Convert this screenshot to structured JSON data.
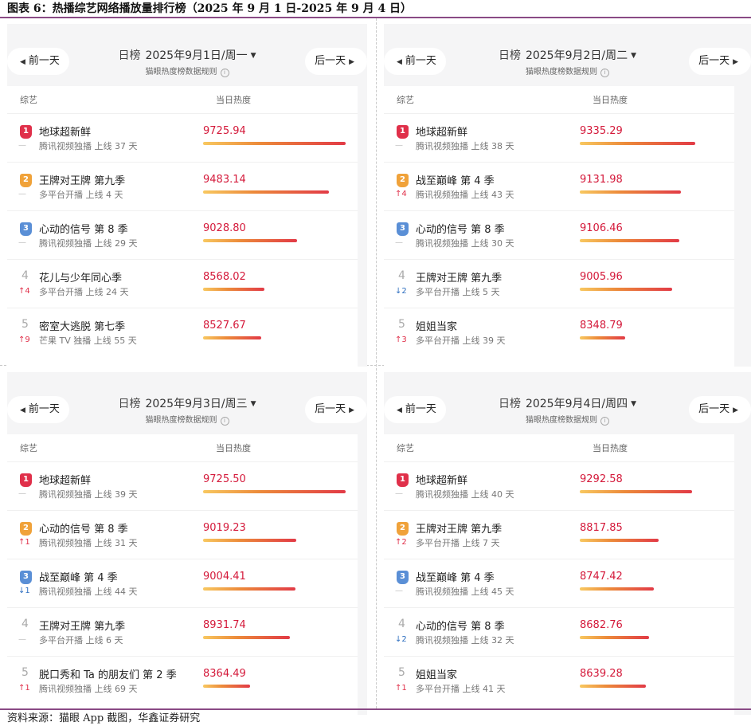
{
  "figure_title": "图表 6：热播综艺网络播放量排行榜（2025 年 9 月 1 日-2025 年 9 月 4 日）",
  "source_note": "资料来源：猫眼 App 截图，华鑫证券研究",
  "colors": {
    "rank1": "#e0304a",
    "rank2": "#f0a23a",
    "rank3": "#5a8fd6",
    "heat": "#d4193a",
    "up": "#e0304a",
    "down": "#2f6fc0"
  },
  "panels": [
    {
      "prev_label": "前一天",
      "next_label": "后一天",
      "board_label": "日榜",
      "date": "2025年9月1日/周一",
      "rule_text": "猫眼热度榜数据规则",
      "col_show": "综艺",
      "col_heat": "当日热度",
      "rows": [
        {
          "rank": "1",
          "trend_dir": "flat",
          "trend": "—",
          "name": "地球超新鲜",
          "sub": "腾讯视频独播 上线 37 天",
          "heat": "9725.94",
          "heat_value": 9725.94
        },
        {
          "rank": "2",
          "trend_dir": "flat",
          "trend": "—",
          "name": "王牌对王牌 第九季",
          "sub": "多平台开播 上线 4 天",
          "heat": "9483.14",
          "heat_value": 9483.14
        },
        {
          "rank": "3",
          "trend_dir": "flat",
          "trend": "—",
          "name": "心动的信号 第 8 季",
          "sub": "腾讯视频独播 上线 29 天",
          "heat": "9028.80",
          "heat_value": 9028.8
        },
        {
          "rank": "4",
          "trend_dir": "up",
          "trend": "↑4",
          "name": "花儿与少年同心季",
          "sub": "多平台开播 上线 24 天",
          "heat": "8568.02",
          "heat_value": 8568.02
        },
        {
          "rank": "5",
          "trend_dir": "up",
          "trend": "↑9",
          "name": "密室大逃脱 第七季",
          "sub": "芒果 TV 独播 上线 55 天",
          "heat": "8527.67",
          "heat_value": 8527.67
        }
      ]
    },
    {
      "prev_label": "前一天",
      "next_label": "后一天",
      "board_label": "日榜",
      "date": "2025年9月2日/周二",
      "rule_text": "猫眼热度榜数据规则",
      "col_show": "综艺",
      "col_heat": "当日热度",
      "rows": [
        {
          "rank": "1",
          "trend_dir": "flat",
          "trend": "—",
          "name": "地球超新鲜",
          "sub": "腾讯视频独播 上线 38 天",
          "heat": "9335.29",
          "heat_value": 9335.29
        },
        {
          "rank": "2",
          "trend_dir": "up",
          "trend": "↑4",
          "name": "战至巅峰 第 4 季",
          "sub": "腾讯视频独播 上线 43 天",
          "heat": "9131.98",
          "heat_value": 9131.98
        },
        {
          "rank": "3",
          "trend_dir": "flat",
          "trend": "—",
          "name": "心动的信号 第 8 季",
          "sub": "腾讯视频独播 上线 30 天",
          "heat": "9106.46",
          "heat_value": 9106.46
        },
        {
          "rank": "4",
          "trend_dir": "down",
          "trend": "↓2",
          "name": "王牌对王牌 第九季",
          "sub": "多平台开播 上线 5 天",
          "heat": "9005.96",
          "heat_value": 9005.96
        },
        {
          "rank": "5",
          "trend_dir": "up",
          "trend": "↑3",
          "name": "姐姐当家",
          "sub": "多平台开播 上线 39 天",
          "heat": "8348.79",
          "heat_value": 8348.79
        }
      ]
    },
    {
      "prev_label": "前一天",
      "next_label": "后一天",
      "board_label": "日榜",
      "date": "2025年9月3日/周三",
      "rule_text": "猫眼热度榜数据规则",
      "col_show": "综艺",
      "col_heat": "当日热度",
      "rows": [
        {
          "rank": "1",
          "trend_dir": "flat",
          "trend": "—",
          "name": "地球超新鲜",
          "sub": "腾讯视频独播 上线 39 天",
          "heat": "9725.50",
          "heat_value": 9725.5
        },
        {
          "rank": "2",
          "trend_dir": "up",
          "trend": "↑1",
          "name": "心动的信号 第 8 季",
          "sub": "腾讯视频独播 上线 31 天",
          "heat": "9019.23",
          "heat_value": 9019.23
        },
        {
          "rank": "3",
          "trend_dir": "down",
          "trend": "↓1",
          "name": "战至巅峰 第 4 季",
          "sub": "腾讯视频独播 上线 44 天",
          "heat": "9004.41",
          "heat_value": 9004.41
        },
        {
          "rank": "4",
          "trend_dir": "flat",
          "trend": "—",
          "name": "王牌对王牌 第九季",
          "sub": "多平台开播 上线 6 天",
          "heat": "8931.74",
          "heat_value": 8931.74
        },
        {
          "rank": "5",
          "trend_dir": "up",
          "trend": "↑1",
          "name": "脱口秀和 Ta 的朋友们 第 2 季",
          "sub": "腾讯视频独播 上线 69 天",
          "heat": "8364.49",
          "heat_value": 8364.49
        }
      ]
    },
    {
      "prev_label": "前一天",
      "next_label": "后一天",
      "board_label": "日榜",
      "date": "2025年9月4日/周四",
      "rule_text": "猫眼热度榜数据规则",
      "col_show": "综艺",
      "col_heat": "当日热度",
      "rows": [
        {
          "rank": "1",
          "trend_dir": "flat",
          "trend": "—",
          "name": "地球超新鲜",
          "sub": "腾讯视频独播 上线 40 天",
          "heat": "9292.58",
          "heat_value": 9292.58
        },
        {
          "rank": "2",
          "trend_dir": "up",
          "trend": "↑2",
          "name": "王牌对王牌 第九季",
          "sub": "多平台开播 上线 7 天",
          "heat": "8817.85",
          "heat_value": 8817.85
        },
        {
          "rank": "3",
          "trend_dir": "flat",
          "trend": "—",
          "name": "战至巅峰 第 4 季",
          "sub": "腾讯视频独播 上线 45 天",
          "heat": "8747.42",
          "heat_value": 8747.42
        },
        {
          "rank": "4",
          "trend_dir": "down",
          "trend": "↓2",
          "name": "心动的信号 第 8 季",
          "sub": "腾讯视频独播 上线 32 天",
          "heat": "8682.76",
          "heat_value": 8682.76
        },
        {
          "rank": "5",
          "trend_dir": "up",
          "trend": "↑1",
          "name": "姐姐当家",
          "sub": "多平台开播 上线 41 天",
          "heat": "8639.28",
          "heat_value": 8639.28
        }
      ]
    }
  ]
}
